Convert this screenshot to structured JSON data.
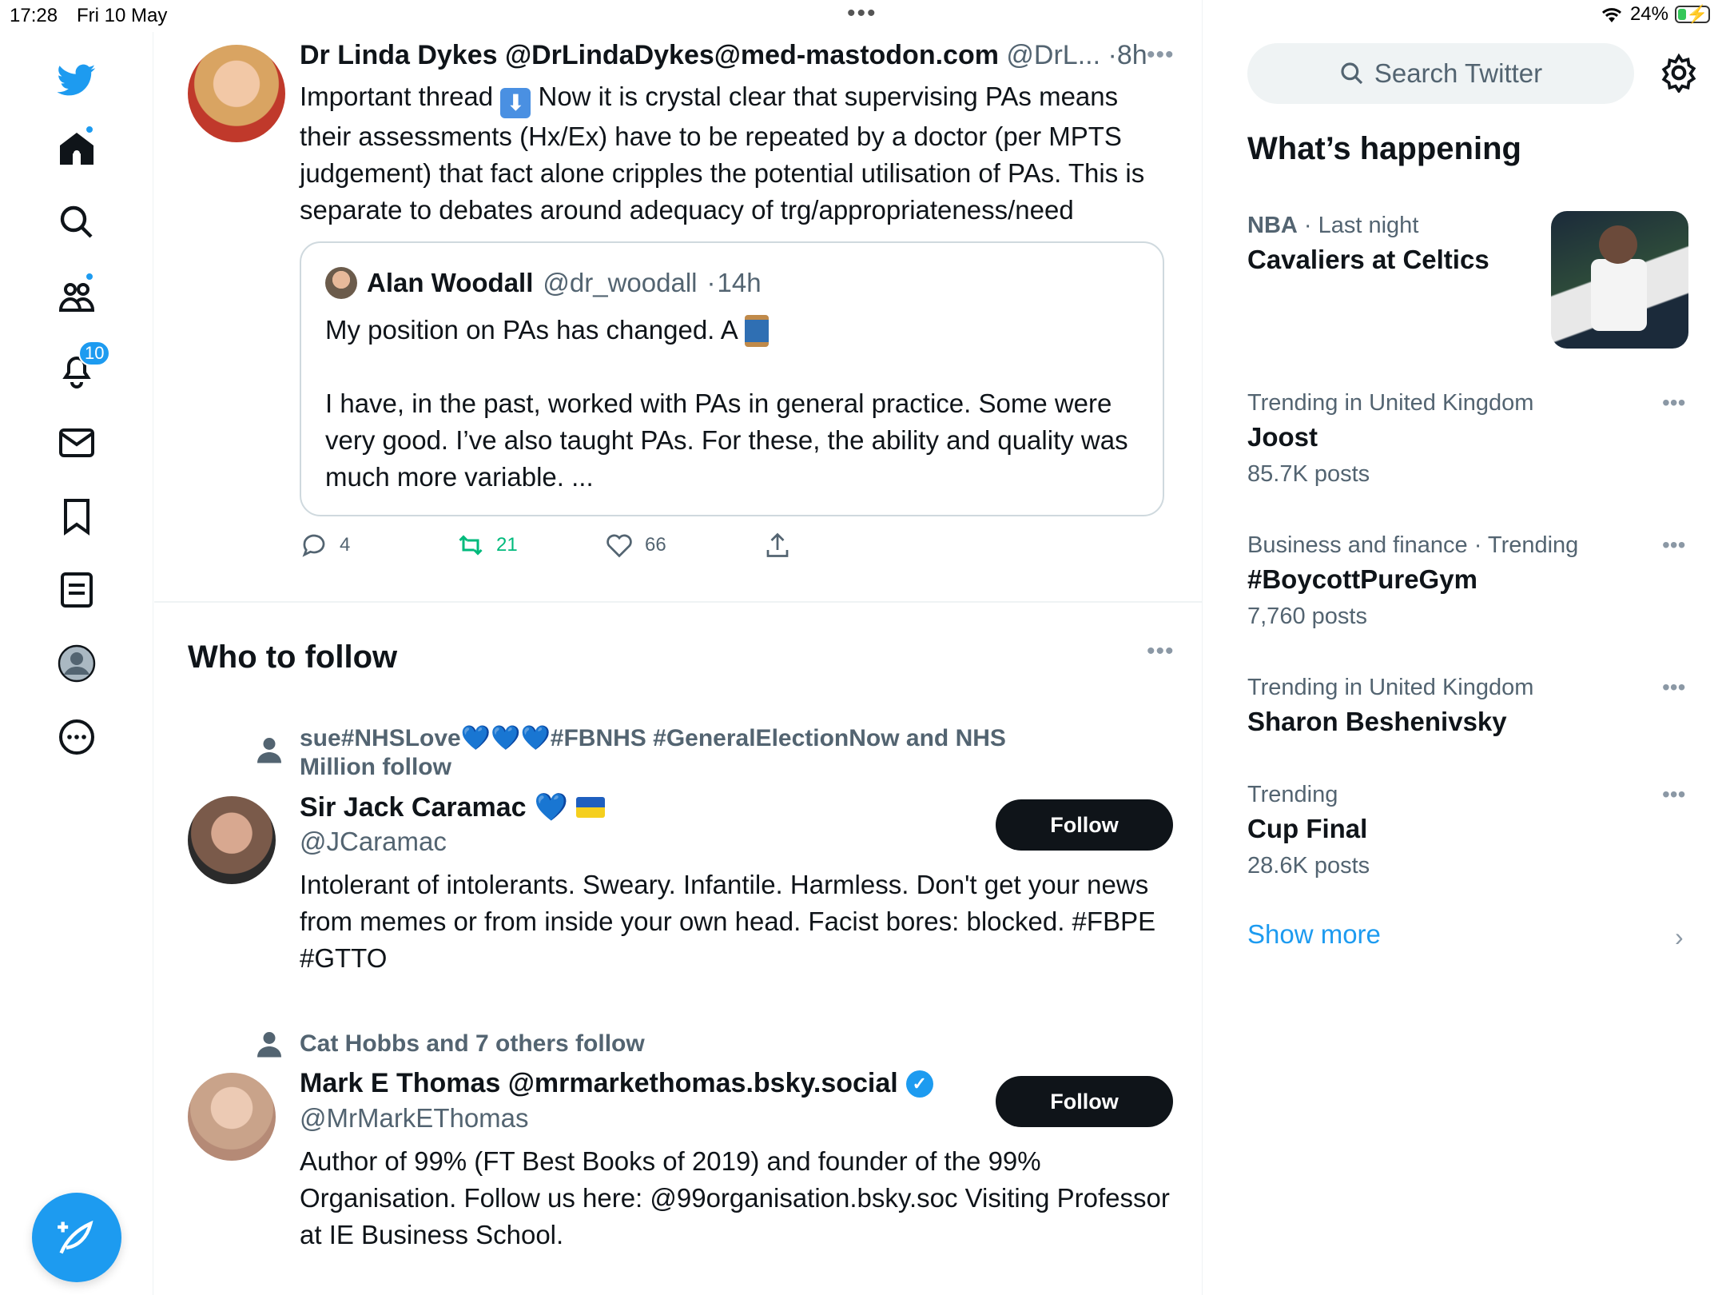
{
  "status_bar": {
    "time": "17:28",
    "date": "Fri 10 May",
    "battery": "24%",
    "battery_level": 0.24
  },
  "nav": {
    "items": [
      "logo-icon",
      "home-icon",
      "search-icon",
      "communities-icon",
      "notifications-icon",
      "messages-icon",
      "bookmarks-icon",
      "lists-icon",
      "profile-icon",
      "more-icon"
    ],
    "notifications_count": "10",
    "accent": "#1d9bf0"
  },
  "tweet": {
    "name": "Dr Linda Dykes @DrLindaDykes@med-mastodon.com",
    "handle": "@DrL...",
    "time": "8h",
    "text_before_emoji": "Important thread ",
    "emoji": "⬇",
    "text_after_emoji": " Now it is crystal clear that supervising PAs means their assessments (Hx/Ex) have to be repeated by a doctor (per MPTS judgement) that fact alone cripples the potential utilisation of PAs. This is separate to debates around adequacy of trg/appropriateness/need",
    "quote": {
      "name": "Alan Woodall",
      "handle": "@dr_woodall",
      "time": "14h",
      "line1": "My position on PAs has changed. A",
      "body": "I have, in the past, worked with PAs in general practice. Some were very good. I’ve also taught PAs. For these, the ability and quality was much more variable. ..."
    },
    "replies": "4",
    "retweets": "21",
    "likes": "66",
    "retweet_color": "#00ba7c"
  },
  "who_to_follow": {
    "title": "Who to follow",
    "users": [
      {
        "context": "sue#NHSLove💙💙💙#FBNHS #GeneralElectionNow and NHS Million follow",
        "name": "Sir Jack Caramac",
        "handle": "@JCaramac",
        "bio": "Intolerant of intolerants. Sweary. Infantile. Harmless. Don't get your news from memes or from inside your own head. Facist bores: blocked. #FBPE #GTTO",
        "button": "Follow"
      },
      {
        "context": "Cat Hobbs and 7 others follow",
        "name": "Mark E Thomas @mrmarkethomas.bsky.social",
        "handle": "@MrMarkEThomas",
        "bio": "Author of 99% (FT Best Books of 2019) and founder of the 99% Organisation. Follow us here: @99organisation.bsky.soc Visiting Professor at IE Business School.",
        "button": "Follow"
      }
    ]
  },
  "sidebar": {
    "search_placeholder": "Search Twitter",
    "title": "What’s happening",
    "trends": [
      {
        "category": "NBA",
        "ctx": " · Last night",
        "topic": "Cavaliers at Celtics",
        "count": ""
      },
      {
        "category": "",
        "ctx": "Trending in United Kingdom",
        "topic": "Joost",
        "count": "85.7K posts"
      },
      {
        "category": "",
        "ctx": "Business and finance · Trending",
        "topic": "#BoycottPureGym",
        "count": "7,760 posts"
      },
      {
        "category": "",
        "ctx": "Trending in United Kingdom",
        "topic": "Sharon Beshenivsky",
        "count": ""
      },
      {
        "category": "",
        "ctx": "Trending",
        "topic": "Cup Final",
        "count": "28.6K posts"
      }
    ],
    "show_more": "Show more"
  }
}
